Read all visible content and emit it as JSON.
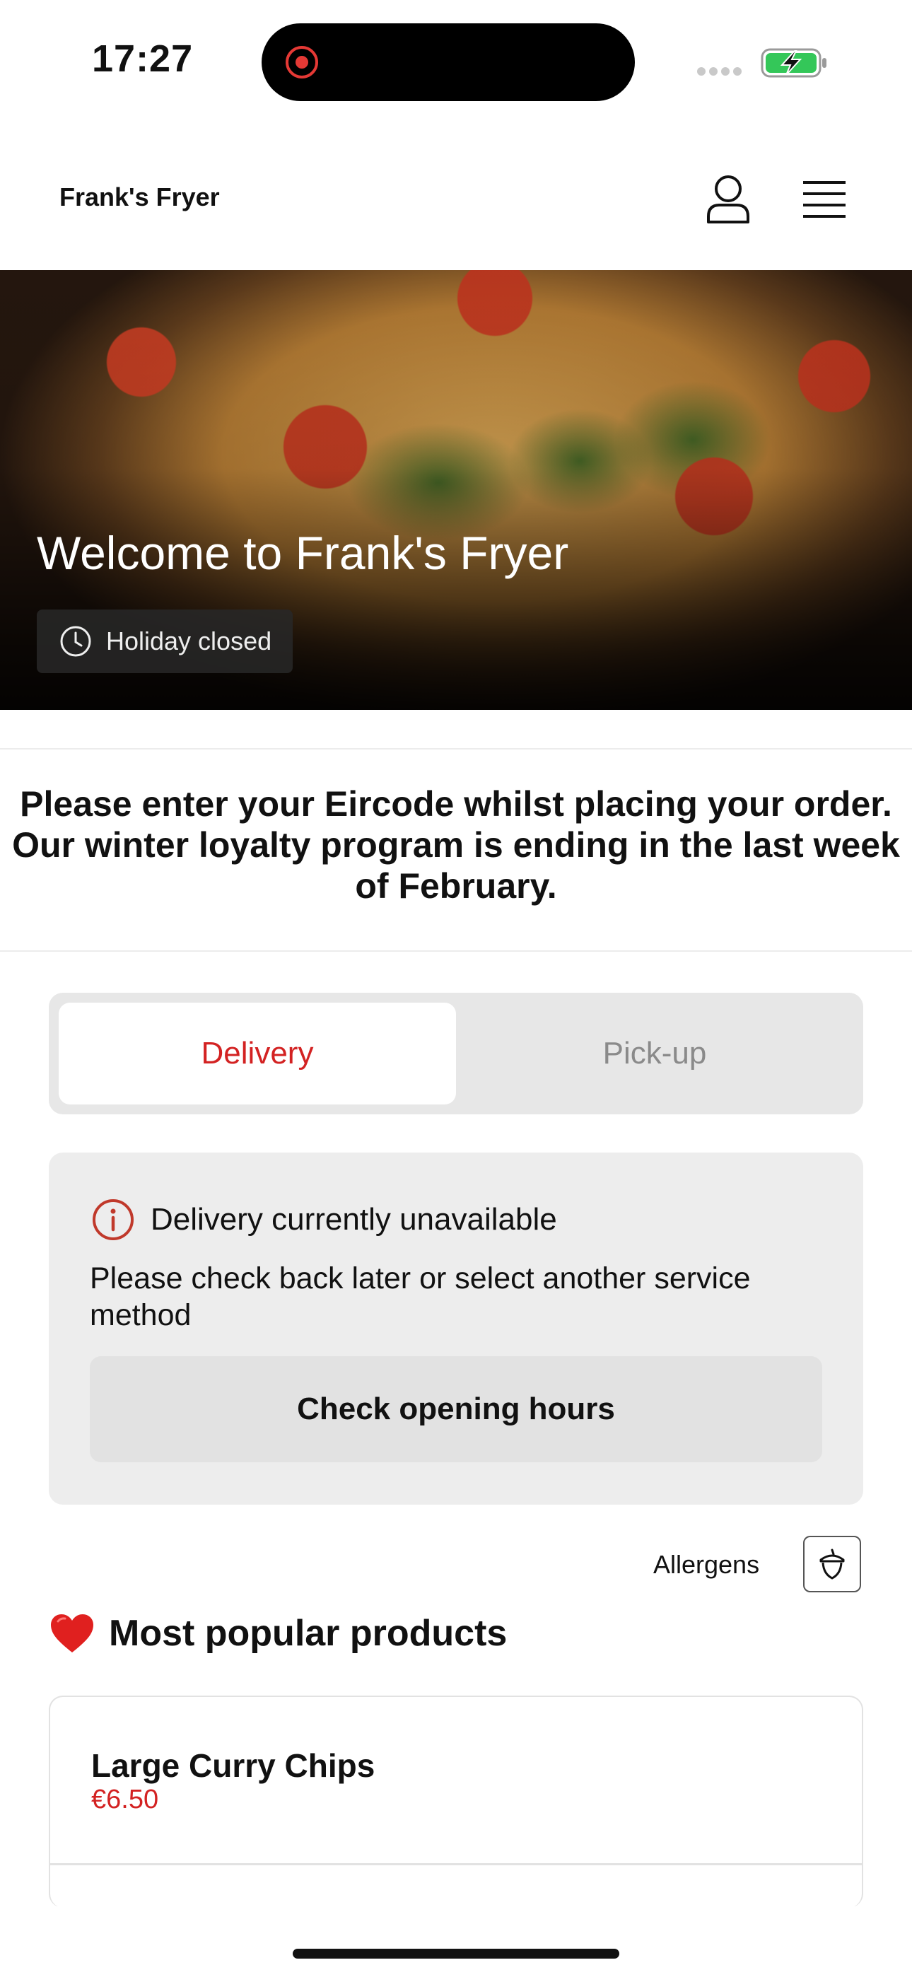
{
  "status_bar": {
    "time": "17:27"
  },
  "header": {
    "brand": "Frank's Fryer"
  },
  "hero": {
    "title": "Welcome to Frank's Fryer",
    "status_badge": "Holiday closed"
  },
  "announcement": {
    "line1": "Please enter your Eircode whilst placing your order.",
    "line2": "Our winter loyalty program is ending in the last week",
    "line3": "of February."
  },
  "service_tabs": {
    "delivery": "Delivery",
    "pickup": "Pick-up",
    "selected": "Delivery"
  },
  "alert": {
    "title": "Delivery currently unavailable",
    "body": "Please check back later or select another service method",
    "button": "Check opening hours"
  },
  "allergens": {
    "label": "Allergens"
  },
  "popular": {
    "title": "Most popular products",
    "products": [
      {
        "name": "Large Curry Chips",
        "price": "€6.50"
      }
    ]
  },
  "colors": {
    "accent": "#d32222",
    "battery": "#34c759"
  }
}
